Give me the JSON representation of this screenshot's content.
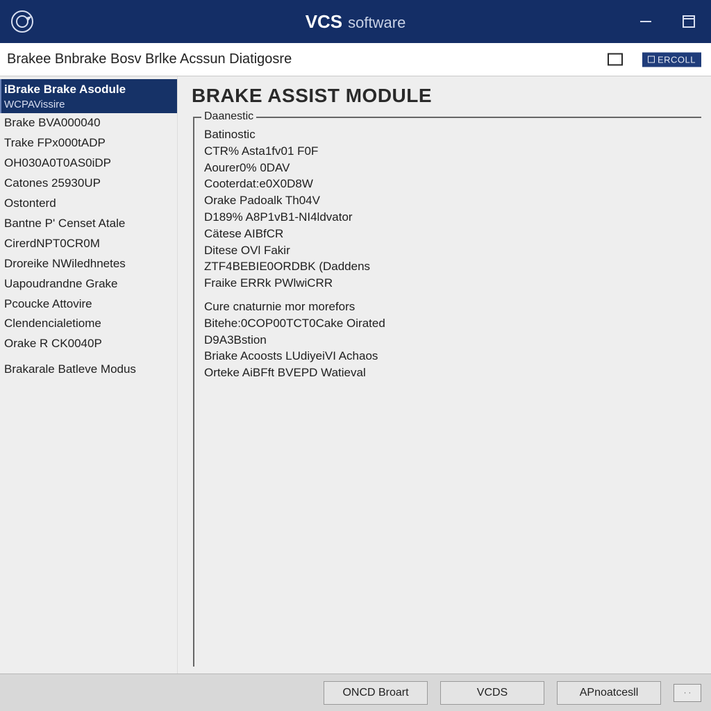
{
  "titlebar": {
    "app_name": "VCS",
    "app_suffix": "software"
  },
  "breadcrumb": {
    "text": "Brakee Bnbrake Bosv Brlke Acssun Diatigosre",
    "badge": "ERCOLL"
  },
  "sidebar": {
    "head": "iBrake Brake Asodule",
    "sub": "WCPAVissire",
    "items": [
      "Brake BVA000040",
      "Trake FPx000tADP",
      "OH030A0T0AS0iDP",
      "Catones 25930UP",
      "Ostonterd",
      "Bantne P' Censet Atale",
      "CirerdNPT0CR0M",
      "Droreike NWiledhnetes",
      "Uapoudrandne Grake",
      "Pcoucke Attovire",
      "Clendencialetiome",
      "Orake R CK0040P"
    ],
    "footer": "Brakarale Batleve Modus"
  },
  "main": {
    "title": "BRAKE ASSIST MODULE",
    "panel_legend": "Daanestic",
    "group1": [
      "Batinostic",
      "CTR% Asta1fv01 F0F",
      "Aourer0% 0DAV",
      "Cooterdat:e0X0D8W",
      "Orake Padoalk Th04V",
      "D189% A8P1vB1-NI4ldvator",
      "Cätese AIBfCR",
      "Ditese OVl Fakir",
      "ZTF4BEBIE0ORDBK (Daddens",
      "Fraike ERRk PWlwiCRR"
    ],
    "group2": [
      "Cure cnaturnie mor morefors",
      "Bitehe:0COP00TCT0Cake Oirated",
      "D9A3Bstion",
      "Briake Acoosts LUdiyeiVI Achaos",
      "Orteke AiBFft BVEPD Watieval"
    ]
  },
  "statusbar": {
    "btn1": "ONCD Broart",
    "btn2": "VCDS",
    "btn3": "APnoatcesll",
    "mini": "· ·"
  }
}
